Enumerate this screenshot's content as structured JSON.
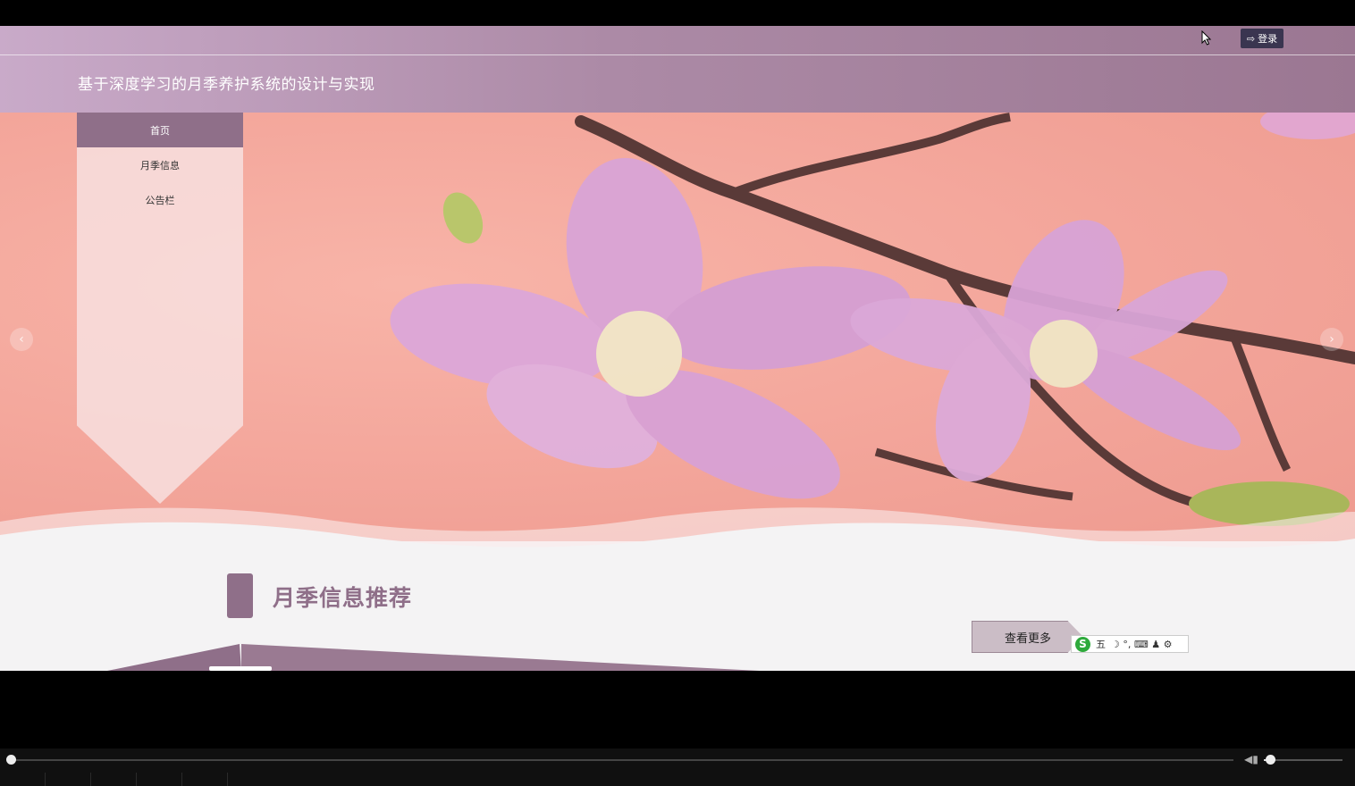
{
  "header": {
    "site_title": "基于深度学习的月季养护系统的设计与实现",
    "login_label": "登录"
  },
  "nav": {
    "items": [
      {
        "label": "首页",
        "active": true
      },
      {
        "label": "月季信息",
        "active": false
      },
      {
        "label": "公告栏",
        "active": false
      }
    ]
  },
  "carousel": {
    "prev_glyph": "‹",
    "next_glyph": "›"
  },
  "section": {
    "title": "月季信息推荐",
    "more_label": "查看更多"
  },
  "ime": {
    "logo": "S",
    "mode": "五",
    "symbols": "☽ °, ⌨ ♟ ⚙"
  },
  "player": {
    "progress": 0.0,
    "volume": 0.08
  },
  "colors": {
    "accent": "#8f6f89",
    "hero_bg": "#f3a59a"
  }
}
